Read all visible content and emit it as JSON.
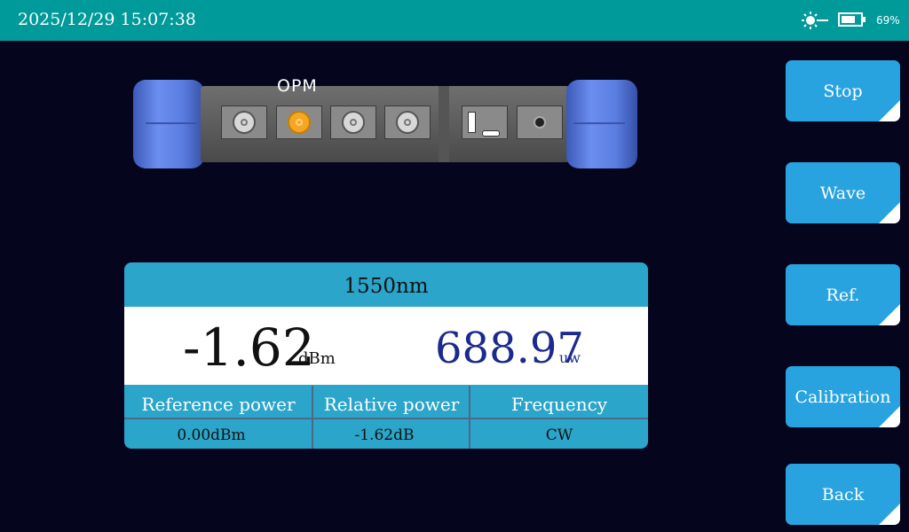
{
  "status_bar": {
    "datetime": "2025/12/29 15:07:38",
    "battery_percent": "69%",
    "battery_level": 0.69,
    "icons": [
      "laser-sun-icon",
      "battery-icon"
    ]
  },
  "device": {
    "mode_label": "OPM",
    "active_port_index": 1
  },
  "measurement": {
    "wavelength": "1550nm",
    "power_dbm_value": "-1.62",
    "power_dbm_unit": "dBm",
    "power_uw_value": "688.97",
    "power_uw_unit": "uw",
    "columns": [
      {
        "header": "Reference power",
        "value": "0.00dBm"
      },
      {
        "header": "Relative power",
        "value": "-1.62dB"
      },
      {
        "header": "Frequency",
        "value": "CW"
      }
    ]
  },
  "buttons": {
    "stop": "Stop",
    "wave": "Wave",
    "ref": "Ref.",
    "calibration": "Calibration",
    "back": "Back"
  },
  "colors": {
    "background": "#05051e",
    "topbar": "#009a9a",
    "button": "#29a3df",
    "panel": "#2ba5c9",
    "uw_text": "#1b2a8c",
    "active_port": "#f5a623"
  }
}
